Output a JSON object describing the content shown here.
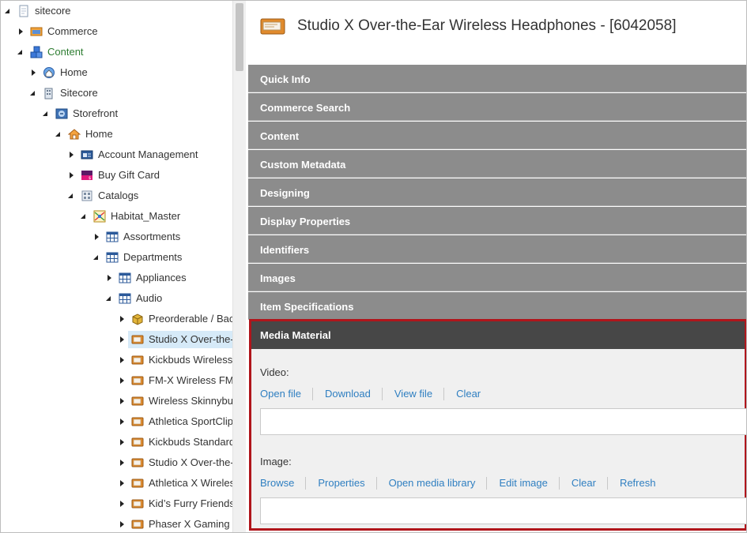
{
  "tree": {
    "items": [
      {
        "label": "sitecore",
        "level": 0,
        "arrow": "expanded",
        "icon": "sitecore-page-icon"
      },
      {
        "label": "Commerce",
        "level": 1,
        "arrow": "collapsed",
        "icon": "commerce-icon"
      },
      {
        "label": "Content",
        "level": 1,
        "arrow": "expanded",
        "icon": "content-cubes-icon",
        "active": true
      },
      {
        "label": "Home",
        "level": 2,
        "arrow": "collapsed",
        "icon": "globe-home-icon"
      },
      {
        "label": "Sitecore",
        "level": 2,
        "arrow": "expanded",
        "icon": "building-icon"
      },
      {
        "label": "Storefront",
        "level": 3,
        "arrow": "expanded",
        "icon": "storefront-icon"
      },
      {
        "label": "Home",
        "level": 4,
        "arrow": "expanded",
        "icon": "house-icon"
      },
      {
        "label": "Account Management",
        "level": 5,
        "arrow": "collapsed",
        "icon": "account-card-icon"
      },
      {
        "label": "Buy Gift Card",
        "level": 5,
        "arrow": "collapsed",
        "icon": "gift-card-icon"
      },
      {
        "label": "Catalogs",
        "level": 5,
        "arrow": "expanded",
        "icon": "catalog-icon"
      },
      {
        "label": "Habitat_Master",
        "level": 6,
        "arrow": "expanded",
        "icon": "master-catalog-icon"
      },
      {
        "label": "Assortments",
        "level": 7,
        "arrow": "collapsed",
        "icon": "grid-table-icon"
      },
      {
        "label": "Departments",
        "level": 7,
        "arrow": "expanded",
        "icon": "grid-table-icon"
      },
      {
        "label": "Appliances",
        "level": 8,
        "arrow": "collapsed",
        "icon": "grid-table-icon"
      },
      {
        "label": "Audio",
        "level": 8,
        "arrow": "expanded",
        "icon": "grid-table-icon"
      },
      {
        "label": "Preorderable / Bac",
        "level": 9,
        "arrow": "collapsed",
        "icon": "package-icon"
      },
      {
        "label": "Studio X Over-the-E",
        "level": 9,
        "arrow": "collapsed",
        "icon": "product-tag-icon",
        "selected": true
      },
      {
        "label": "Kickbuds Wireless I",
        "level": 9,
        "arrow": "collapsed",
        "icon": "product-tag-icon"
      },
      {
        "label": "FM-X Wireless FM C",
        "level": 9,
        "arrow": "collapsed",
        "icon": "product-tag-icon"
      },
      {
        "label": "Wireless Skinnybud",
        "level": 9,
        "arrow": "collapsed",
        "icon": "product-tag-icon"
      },
      {
        "label": "Athletica SportClip",
        "level": 9,
        "arrow": "collapsed",
        "icon": "product-tag-icon"
      },
      {
        "label": "Kickbuds Standard",
        "level": 9,
        "arrow": "collapsed",
        "icon": "product-tag-icon"
      },
      {
        "label": "Studio X Over-the-E",
        "level": 9,
        "arrow": "collapsed",
        "icon": "product-tag-icon"
      },
      {
        "label": "Athletica X Wireless",
        "level": 9,
        "arrow": "collapsed",
        "icon": "product-tag-icon"
      },
      {
        "label": "Kid’s Furry Friends",
        "level": 9,
        "arrow": "collapsed",
        "icon": "product-tag-icon"
      },
      {
        "label": "Phaser X Gaming S",
        "level": 9,
        "arrow": "collapsed",
        "icon": "product-tag-icon"
      }
    ]
  },
  "editor": {
    "title": "Studio X Over-the-Ear Wireless Headphones - [6042058]",
    "title_icon": "product-tag-icon",
    "sections": [
      "Quick Info",
      "Commerce Search",
      "Content",
      "Custom Metadata",
      "Designing",
      "Display Properties",
      "Identifiers",
      "Images",
      "Item Specifications"
    ],
    "media": {
      "title": "Media Material",
      "video": {
        "label": "Video:",
        "actions": [
          "Open file",
          "Download",
          "View file",
          "Clear"
        ]
      },
      "image": {
        "label": "Image:",
        "actions": [
          "Browse",
          "Properties",
          "Open media library",
          "Edit image",
          "Clear",
          "Refresh"
        ]
      }
    }
  },
  "colors": {
    "section_bg": "#8c8c8c",
    "active_section_bg": "#474747",
    "highlight_border": "#b0151b",
    "link": "#2f7fc1",
    "active_tree": "#2e7d32",
    "selected_row": "#d6eaf8"
  }
}
